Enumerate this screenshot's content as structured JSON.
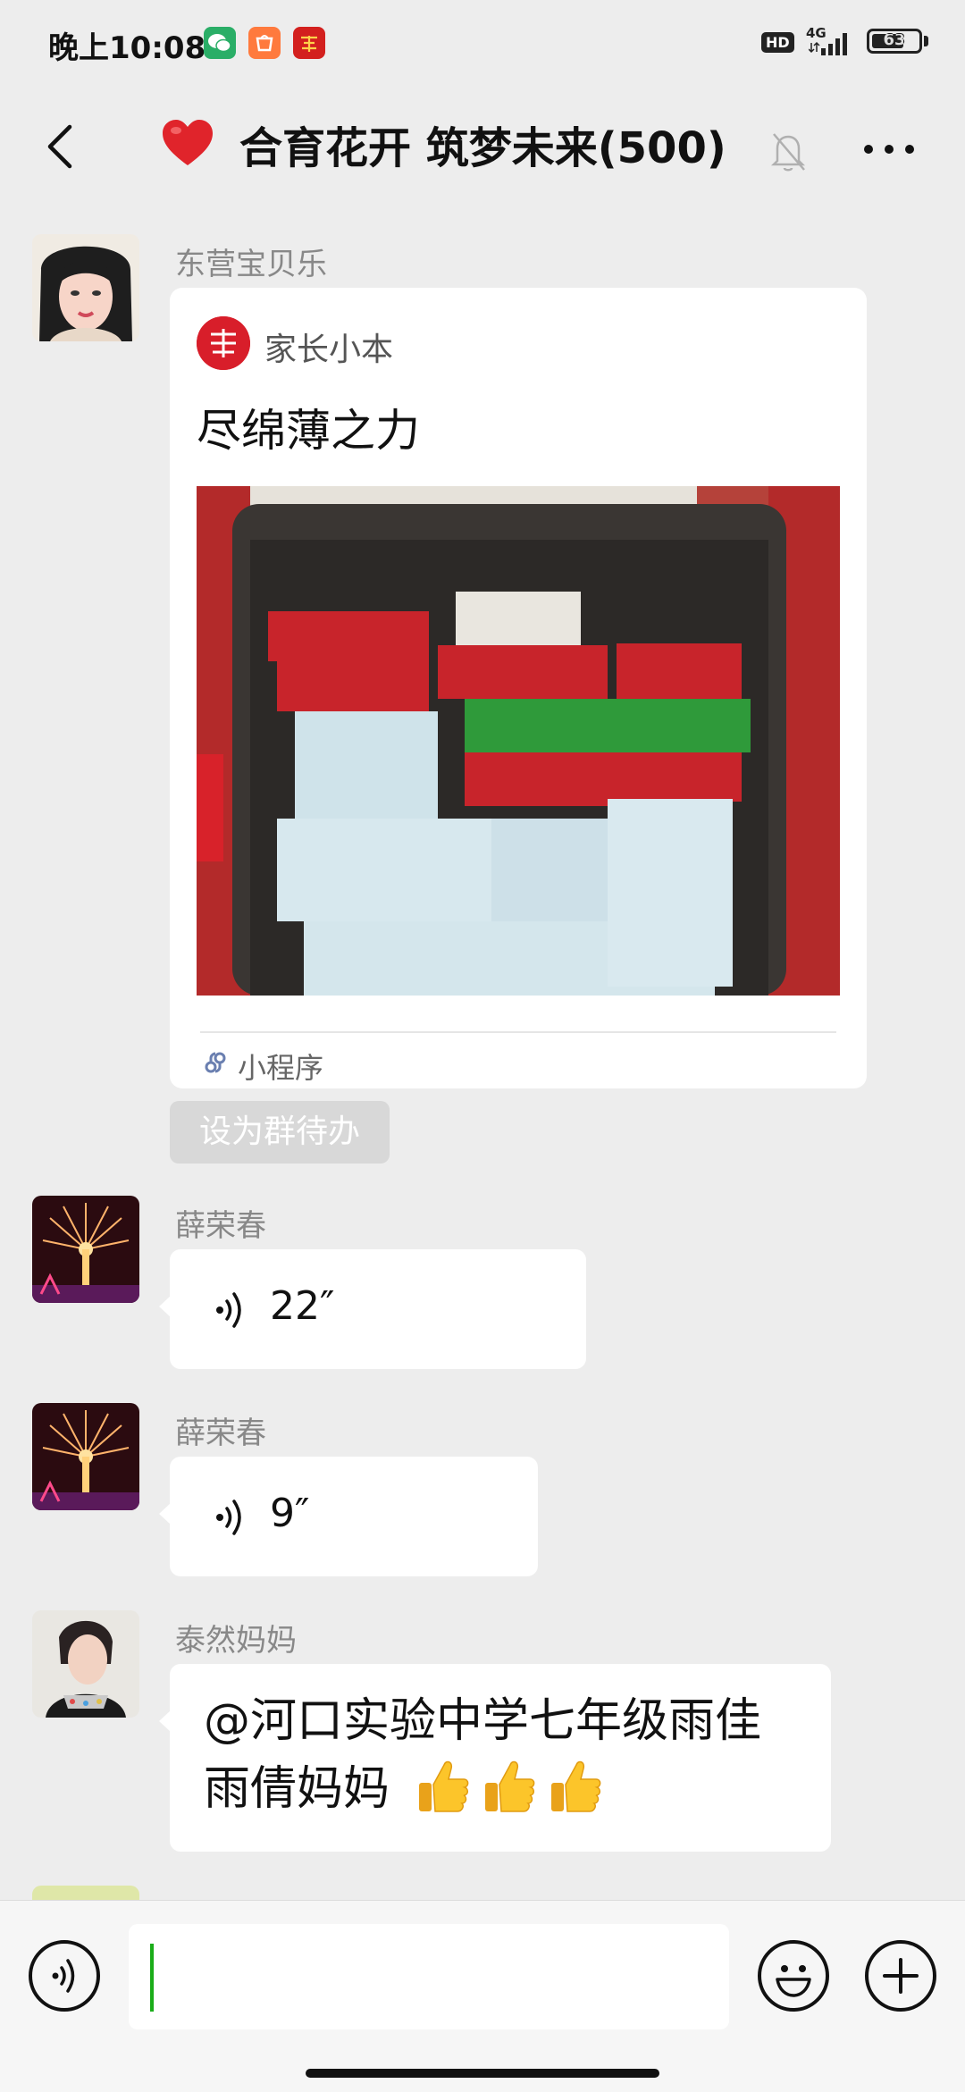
{
  "status_bar": {
    "time": "晚上10:08",
    "apps": [
      "wechat-icon",
      "taobao-icon",
      "xuexi-icon"
    ],
    "hd": "HD",
    "network": "4G",
    "battery": "63"
  },
  "nav": {
    "title": "合育花开 筑梦未来(500)",
    "title_emoji": "heart-icon",
    "muted": true
  },
  "messages": [
    {
      "sender": "东营宝贝乐",
      "type": "mini_program",
      "card": {
        "source": "家长小本",
        "logo_text": "家长小本",
        "title": "尽绵薄之力",
        "type_label": "小程序"
      },
      "action": "设为群待办"
    },
    {
      "sender": "薛荣春",
      "type": "voice",
      "duration": "22″"
    },
    {
      "sender": "薛荣春",
      "type": "voice",
      "duration": "9″"
    },
    {
      "sender": "泰然妈妈",
      "type": "text",
      "text": "@河口实验中学七年级雨佳雨倩妈妈 ",
      "emojis": [
        "thumbs-up-icon",
        "thumbs-up-icon",
        "thumbs-up-icon"
      ]
    }
  ],
  "input": {
    "value": "",
    "placeholder": ""
  },
  "colors": {
    "background": "#ededed",
    "bubble": "#ffffff",
    "accent_green": "#1aad19",
    "logo_red": "#d81e2a"
  }
}
